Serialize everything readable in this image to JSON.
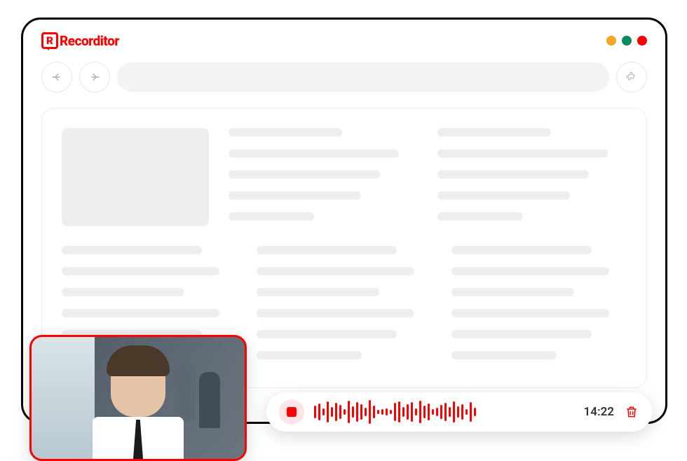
{
  "app": {
    "name": "Recorditor",
    "logo_letter": "R"
  },
  "window_controls": {
    "colors": [
      "#f5a623",
      "#0a8a5f",
      "#f00"
    ]
  },
  "recording": {
    "timestamp": "14:22",
    "waveform_heights": [
      18,
      24,
      10,
      30,
      14,
      26,
      20,
      8,
      32,
      16,
      28,
      22,
      12,
      34,
      18,
      6,
      8,
      10,
      6,
      26,
      30,
      14,
      22,
      28,
      10,
      32,
      18,
      24,
      8,
      12,
      20,
      26,
      14,
      30,
      16,
      22,
      8,
      28,
      12
    ]
  },
  "colors": {
    "accent": "#f00",
    "skeleton": "#eee",
    "border": "#e5e5e5"
  }
}
